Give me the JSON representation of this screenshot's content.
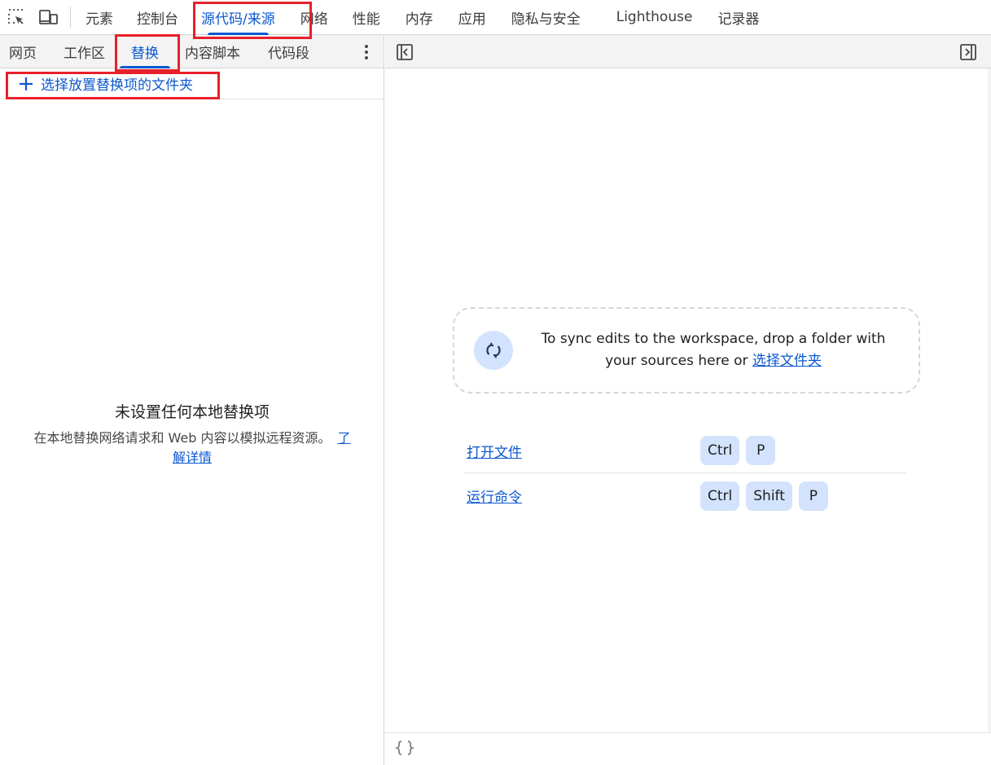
{
  "main_tabs": [
    {
      "label": "元素",
      "active": false
    },
    {
      "label": "控制台",
      "active": false
    },
    {
      "label": "源代码/来源",
      "active": true
    },
    {
      "label": "网络",
      "active": false
    },
    {
      "label": "性能",
      "active": false
    },
    {
      "label": "内存",
      "active": false
    },
    {
      "label": "应用",
      "active": false
    },
    {
      "label": "隐私与安全",
      "active": false
    },
    {
      "label": "Lighthouse",
      "active": false
    },
    {
      "label": "记录器",
      "active": false
    }
  ],
  "toolbar_icons": [
    "inspect-element-icon",
    "device-toolbar-icon"
  ],
  "sources_sidebar": {
    "tabs": [
      {
        "label": "网页",
        "active": false
      },
      {
        "label": "工作区",
        "active": false
      },
      {
        "label": "替换",
        "active": true
      },
      {
        "label": "内容脚本",
        "active": false
      },
      {
        "label": "代码段",
        "active": false
      }
    ],
    "add_folder_label": "选择放置替换项的文件夹",
    "empty_title": "未设置任何本地替换项",
    "empty_desc": "在本地替换网络请求和 Web 内容以模拟远程资源。",
    "learn_more": "了解详情"
  },
  "editor": {
    "dropzone_text": "To sync edits to the workspace, drop a folder with your sources here or",
    "dropzone_link": "选择文件夹",
    "shortcuts": [
      {
        "label": "打开文件",
        "keys": [
          "Ctrl",
          "P"
        ]
      },
      {
        "label": "运行命令",
        "keys": [
          "Ctrl",
          "Shift",
          "P"
        ]
      }
    ]
  },
  "colors": {
    "accent": "#0b57d0",
    "key_background": "#d3e3fd",
    "highlight_border": "#e8202a"
  }
}
